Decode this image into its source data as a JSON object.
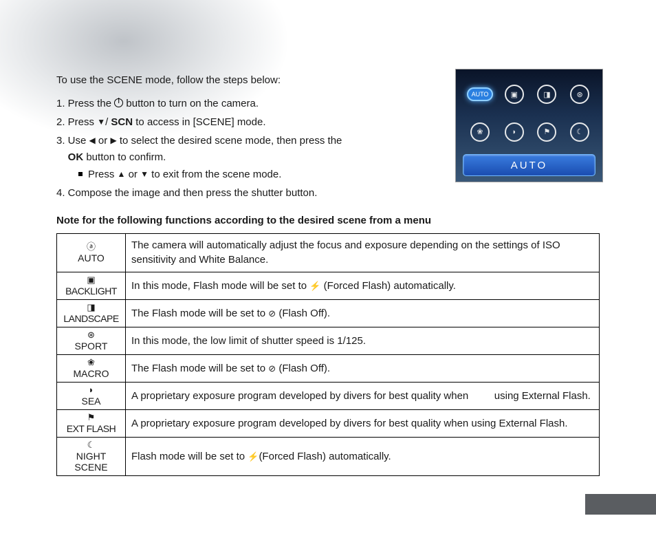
{
  "intro": "To use the SCENE mode, follow the steps below:",
  "steps": {
    "s1_a": "1. Press the ",
    "s1_b": " button to turn on the camera.",
    "s2_a": "2. Press ",
    "s2_b": "/ ",
    "s2_scn": "SCN",
    "s2_c": " to access in [SCENE] mode.",
    "s3_a": "3. Use ",
    "s3_b": " or ",
    "s3_c": " to select the desired scene mode, then press the",
    "s3_ok": "OK",
    "s3_d": " button to confirm.",
    "s3_sub_a": "Press ",
    "s3_sub_b": " or ",
    "s3_sub_c": " to exit from the scene mode.",
    "s4": "4. Compose the image and then press the shutter button."
  },
  "note_heading": "Note for the following functions according to the desired scene from a menu",
  "table": {
    "auto": {
      "label": "AUTO",
      "desc": "The camera will automatically adjust the focus and exposure depending on the settings of ISO sensitivity and White Balance."
    },
    "backlight": {
      "label": "BACKLIGHT",
      "desc_a": "In this mode, Flash mode will be set to ",
      "desc_b": " (Forced Flash) automatically."
    },
    "landscape": {
      "label": "LANDSCAPE",
      "desc_a": "The Flash mode will be set to ",
      "desc_b": " (Flash Off)."
    },
    "sport": {
      "label": "SPORT",
      "desc": "In this mode, the low limit of shutter speed is 1/125."
    },
    "macro": {
      "label": "MACRO",
      "desc_a": "The Flash mode will be set to ",
      "desc_b": " (Flash Off)."
    },
    "sea": {
      "label": "SEA",
      "desc": "A proprietary exposure program developed by divers for best quality when         using External Flash."
    },
    "extflash": {
      "label": "EXT FLASH",
      "desc": "A proprietary exposure program developed by divers for best quality when using External Flash."
    },
    "night": {
      "label_a": "NIGHT",
      "label_b": "SCENE",
      "desc_a": "Flash mode will be set to ",
      "desc_b": "(Forced Flash) automatically."
    }
  },
  "preview": {
    "selected_label": "AUTO",
    "bar_label": "AUTO"
  },
  "glyphs": {
    "tri_down": "▼",
    "tri_up": "▲",
    "tri_left": "◀",
    "tri_right": "▶",
    "flash": "⚡",
    "flash_off": "⊘",
    "auto_small": "ⓐ",
    "backlight": "▣",
    "landscape": "◨",
    "sport": "⊛",
    "macro": "❀",
    "sea": "◗",
    "extflash": "⚑",
    "night": "☾"
  }
}
